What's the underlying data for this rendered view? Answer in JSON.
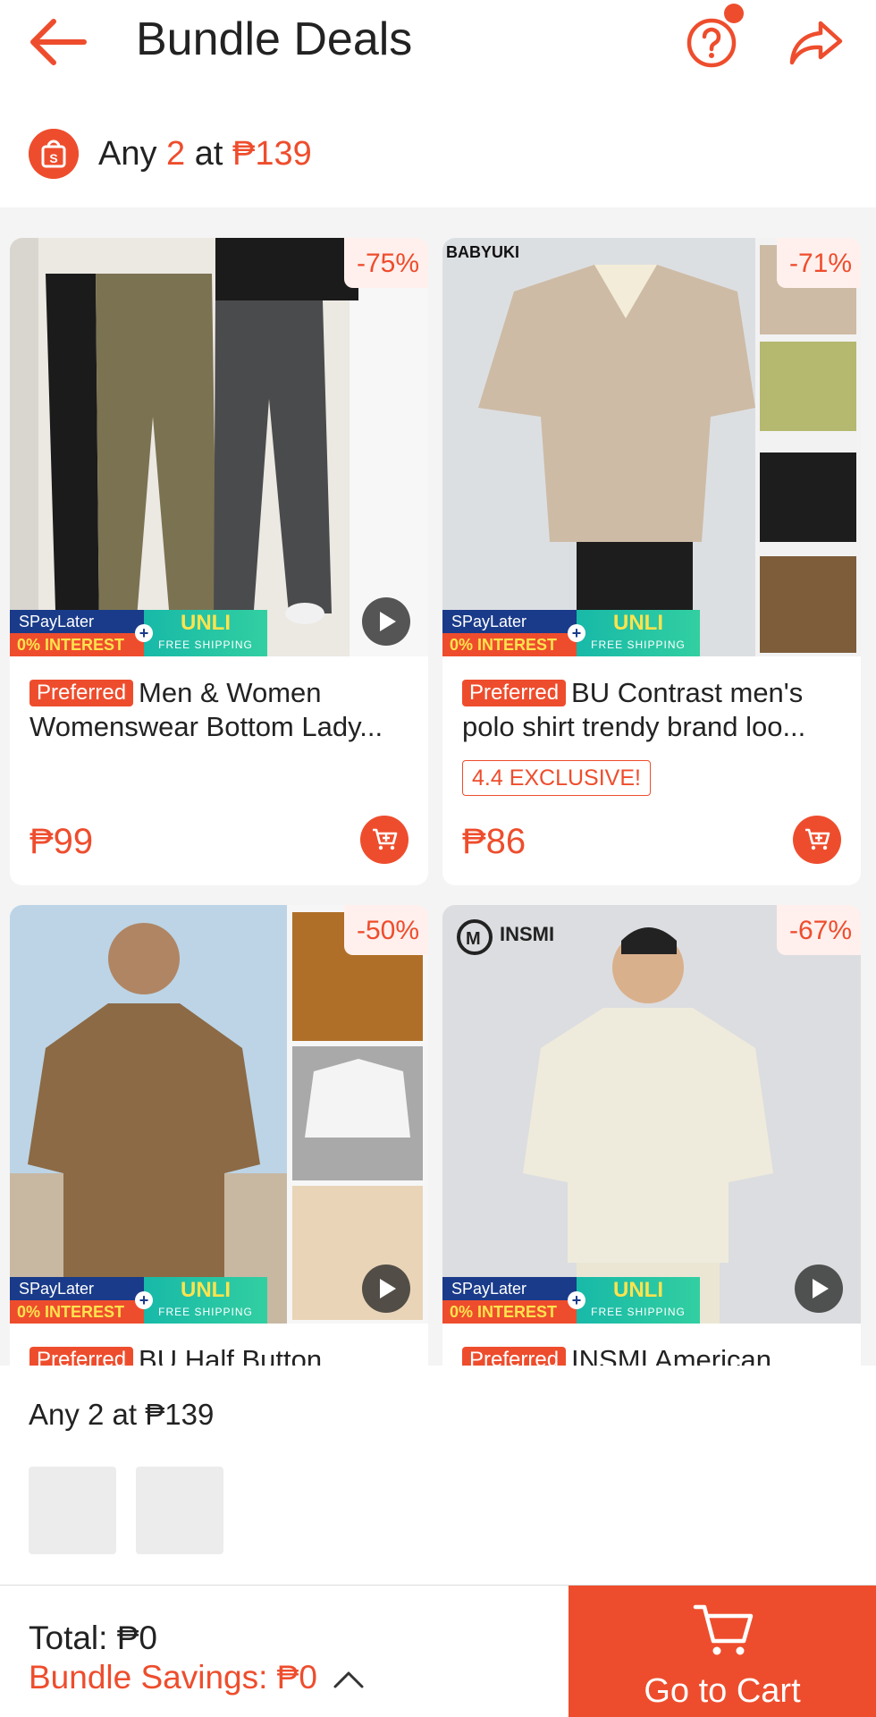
{
  "header": {
    "title": "Bundle Deals"
  },
  "deal": {
    "prefix": "Any ",
    "count": "2",
    "mid": " at ",
    "price": "₱139"
  },
  "products": [
    {
      "discount": "-75%",
      "badge": "Preferred",
      "name": "Men & Women Womenswear Bottom Lady...",
      "price": "₱99",
      "has_video": true,
      "image_text": "",
      "colors": [
        "#ece8e2",
        "#7b7252",
        "#4a4b4d",
        "#1b1b1b"
      ]
    },
    {
      "discount": "-71%",
      "badge": "Preferred",
      "name": "BU Contrast men's polo shirt trendy brand loo...",
      "tag": "4.4 EXCLUSIVE!",
      "price": "₱86",
      "has_video": false,
      "image_text": "BABYUKI",
      "colors": [
        "#dcdfe2",
        "#cdbba5",
        "#b5b86f",
        "#1d1d1d",
        "#7d5d3a"
      ]
    },
    {
      "discount": "-50%",
      "badge": "Preferred",
      "name": "BU Half Button",
      "price": "",
      "has_video": true,
      "image_text": "",
      "colors": [
        "#bcd4e6",
        "#8c6a45",
        "#b06f28",
        "#f4f4f4",
        "#e9d4b8"
      ]
    },
    {
      "discount": "-67%",
      "badge": "Preferred",
      "name": "INSMI American",
      "price": "",
      "has_video": true,
      "image_text": "INSMI",
      "colors": [
        "#dcdde0",
        "#efebdc",
        "#222222"
      ]
    }
  ],
  "promo": {
    "spay_top": "SPayLater",
    "spay_bottom": "0% INTEREST",
    "unli": "UNLI",
    "unli_sub": "FREE SHIPPING"
  },
  "selection": {
    "text": "Any 2 at ₱139"
  },
  "footer": {
    "total": "Total: ₱0",
    "savings": "Bundle Savings: ₱0",
    "cta": "Go to Cart"
  },
  "colors": {
    "accent": "#ee4d2d"
  }
}
